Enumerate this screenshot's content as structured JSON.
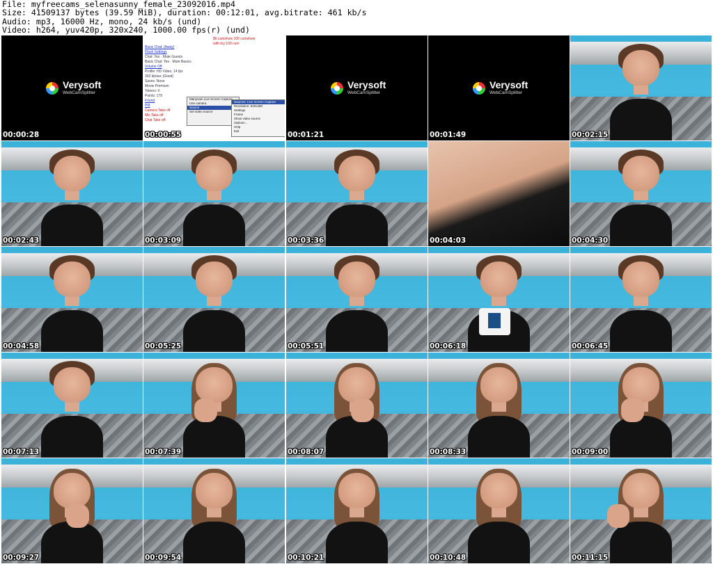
{
  "info": {
    "file": "File: myfreecams_selenasunny_female_23092016.mp4",
    "size": "Size: 41509137 bytes (39.59 MiB), duration: 00:12:01, avg.bitrate: 461 kb/s",
    "audio": "Audio: mp3, 16000 Hz, mono, 24 kb/s (und)",
    "video": "Video: h264, yuv420p, 320x240, 1000.00 fps(r) (und)"
  },
  "logo": {
    "name": "Verysoft",
    "sub": "WebCamSplitter"
  },
  "thumbnails": [
    {
      "time": "00:00:28",
      "kind": "logo"
    },
    {
      "time": "00:00:55",
      "kind": "screenshot"
    },
    {
      "time": "00:01:21",
      "kind": "logo"
    },
    {
      "time": "00:01:49",
      "kind": "logo"
    },
    {
      "time": "00:02:15",
      "kind": "person"
    },
    {
      "time": "00:02:43",
      "kind": "person"
    },
    {
      "time": "00:03:09",
      "kind": "person"
    },
    {
      "time": "00:03:36",
      "kind": "person"
    },
    {
      "time": "00:04:03",
      "kind": "closeup"
    },
    {
      "time": "00:04:30",
      "kind": "person"
    },
    {
      "time": "00:04:58",
      "kind": "person"
    },
    {
      "time": "00:05:25",
      "kind": "person"
    },
    {
      "time": "00:05:51",
      "kind": "person"
    },
    {
      "time": "00:06:18",
      "kind": "mug"
    },
    {
      "time": "00:06:45",
      "kind": "person"
    },
    {
      "time": "00:07:13",
      "kind": "person"
    },
    {
      "time": "00:07:39",
      "kind": "person-long-hand"
    },
    {
      "time": "00:08:07",
      "kind": "person-long-hand"
    },
    {
      "time": "00:08:33",
      "kind": "person-long"
    },
    {
      "time": "00:09:00",
      "kind": "person-long-hand"
    },
    {
      "time": "00:09:27",
      "kind": "person-long-hand"
    },
    {
      "time": "00:09:54",
      "kind": "person-long"
    },
    {
      "time": "00:10:21",
      "kind": "person-long"
    },
    {
      "time": "00:10:48",
      "kind": "person-long"
    },
    {
      "time": "00:11:15",
      "kind": "person-long-hand"
    }
  ],
  "screenshot": {
    "left_lines": [
      {
        "text": "Basic Chat: (Away)",
        "style": "link"
      },
      {
        "text": "Flash Settings",
        "style": "link"
      },
      {
        "text": "Chat: Yes · Mute Guests",
        "style": "plain"
      },
      {
        "text": "Basic Chat: Yes · Mute Basics",
        "style": "plain"
      },
      {
        "text": "Volume Off",
        "style": "link"
      },
      {
        "text": "Profile: HD Video, 14 fps",
        "style": "plain"
      },
      {
        "text": "302 kb/sec (Good)",
        "style": "plain"
      },
      {
        "text": "Saves: None",
        "style": "plain"
      },
      {
        "text": "Movie  Premium",
        "style": "plain"
      },
      {
        "text": "Tokens: 0",
        "style": "plain"
      },
      {
        "text": "Points: 179",
        "style": "plain"
      },
      {
        "text": "Friend",
        "style": "link"
      },
      {
        "text": "PM",
        "style": "link"
      },
      {
        "text": "Camera Take off",
        "style": "red"
      },
      {
        "text": "Mic Take off",
        "style": "red"
      },
      {
        "text": "Chat Take off",
        "style": "red"
      }
    ],
    "right_lines": [
      {
        "text": "$6.cumshow 100 cumshow",
        "style": "red"
      },
      {
        "text": "with toy:100 cum",
        "style": "red"
      }
    ],
    "menu1": [
      "Manycam Live Screen Capture",
      "Use camera",
      "Source",
      "Set video source"
    ],
    "menu2": [
      "Sources: Live Screen Capture",
      "Resolution: 640x480",
      "Settings",
      "Frame",
      "Show video source",
      "Options...",
      "Help",
      "Exit"
    ]
  }
}
